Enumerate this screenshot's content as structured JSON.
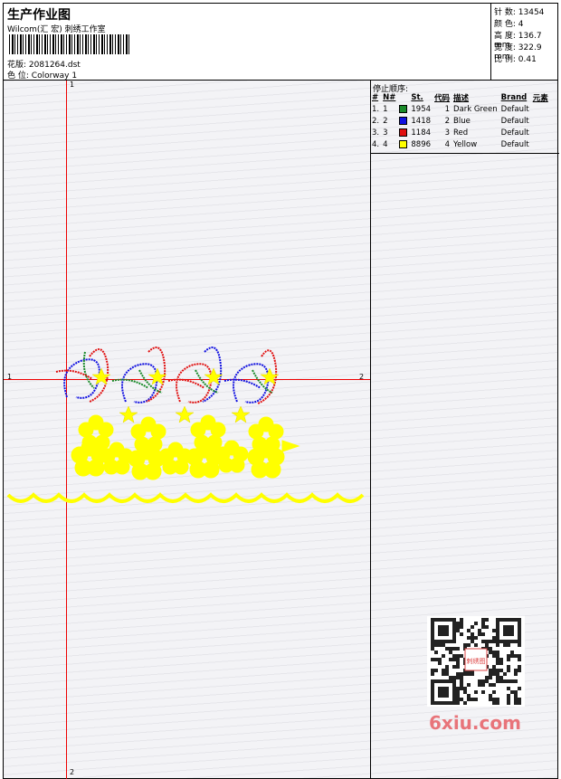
{
  "header": {
    "title": "生产作业图",
    "company": "Wilcom(汇 宏) 刺绣工作室",
    "design_label": "花版:",
    "design_value": "2081264.dst",
    "colorway_label": "色 位:",
    "colorway_value": "Colorway 1"
  },
  "stats": [
    {
      "label": "针 数:",
      "value": "13454"
    },
    {
      "label": "颜 色:",
      "value": "4"
    },
    {
      "label": "高 度:",
      "value": "136.7 mm"
    },
    {
      "label": "宽 度:",
      "value": "322.9 mm"
    },
    {
      "label": "比 例:",
      "value": "0.41"
    }
  ],
  "stop_sequence": {
    "title": "停止顺序:",
    "columns": [
      "#",
      "N#",
      "St.",
      "代码",
      "描述",
      "Brand",
      "元素"
    ],
    "rows": [
      {
        "idx": "1.",
        "n": "1",
        "color": "#1a8a2a",
        "stitches": "1954",
        "code": "1",
        "desc": "Dark Green",
        "brand": "Default"
      },
      {
        "idx": "2.",
        "n": "2",
        "color": "#1010e0",
        "stitches": "1418",
        "code": "2",
        "desc": "Blue",
        "brand": "Default"
      },
      {
        "idx": "3.",
        "n": "3",
        "color": "#e01010",
        "stitches": "1184",
        "code": "3",
        "desc": "Red",
        "brand": "Default"
      },
      {
        "idx": "4.",
        "n": "4",
        "color": "#ffff00",
        "stitches": "8896",
        "code": "4",
        "desc": "Yellow",
        "brand": "Default"
      }
    ]
  },
  "markers": {
    "v_top": "1",
    "v_bottom": "2",
    "h_left": "1",
    "h_right": "2"
  },
  "watermark": "6xiu.com",
  "qr_text": "刺绣图"
}
